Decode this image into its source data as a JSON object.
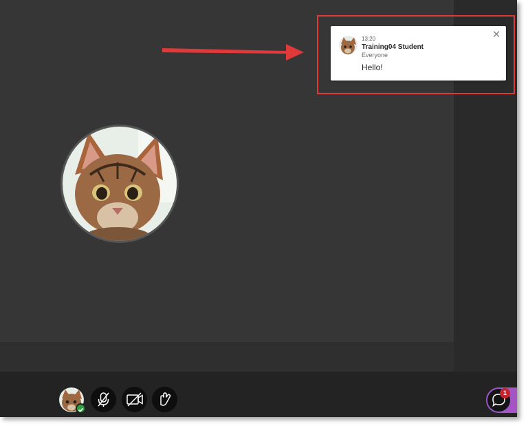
{
  "notification": {
    "time": "13:20",
    "sender": "Training04 Student",
    "audience": "Everyone",
    "message": "Hello!",
    "close_glyph": "✕"
  },
  "chat": {
    "unread_count": "1"
  },
  "toolbar": {
    "buttons": [
      "mic-off-icon",
      "camera-off-icon",
      "raise-hand-icon"
    ]
  },
  "colors": {
    "stage": "#363636",
    "toolbar": "#232323",
    "highlight": "#e0393a",
    "chat_accent": "#a653c6",
    "badge": "#c4242b",
    "status_ok": "#2e9e3f"
  }
}
